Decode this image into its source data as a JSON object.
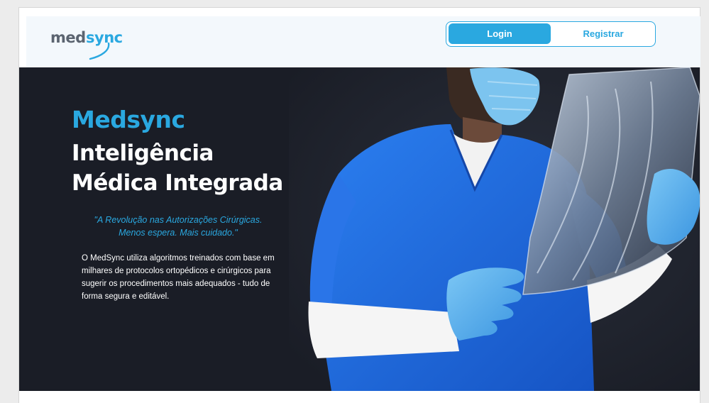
{
  "logo": {
    "part1": "med",
    "part2": "sync"
  },
  "auth": {
    "login_label": "Login",
    "register_label": "Registrar"
  },
  "hero": {
    "brand": "Medsync",
    "subtitle_line1": "Inteligência",
    "subtitle_line2": "Médica Integrada",
    "quote_line1": "\"A Revolução nas Autorizações Cirúrgicas.",
    "quote_line2": "Menos espera. Mais cuidado.\"",
    "description": "O MedSync utiliza algoritmos treinados com base em milhares de protocolos ortopédicos e cirúrgicos para sugerir os procedimentos mais adequados - tudo de forma segura e editável."
  },
  "colors": {
    "accent": "#2aa8e0",
    "hero_bg": "#1a1d26",
    "header_bg": "#f3f8fc",
    "scrubs": "#1f6fe0"
  }
}
